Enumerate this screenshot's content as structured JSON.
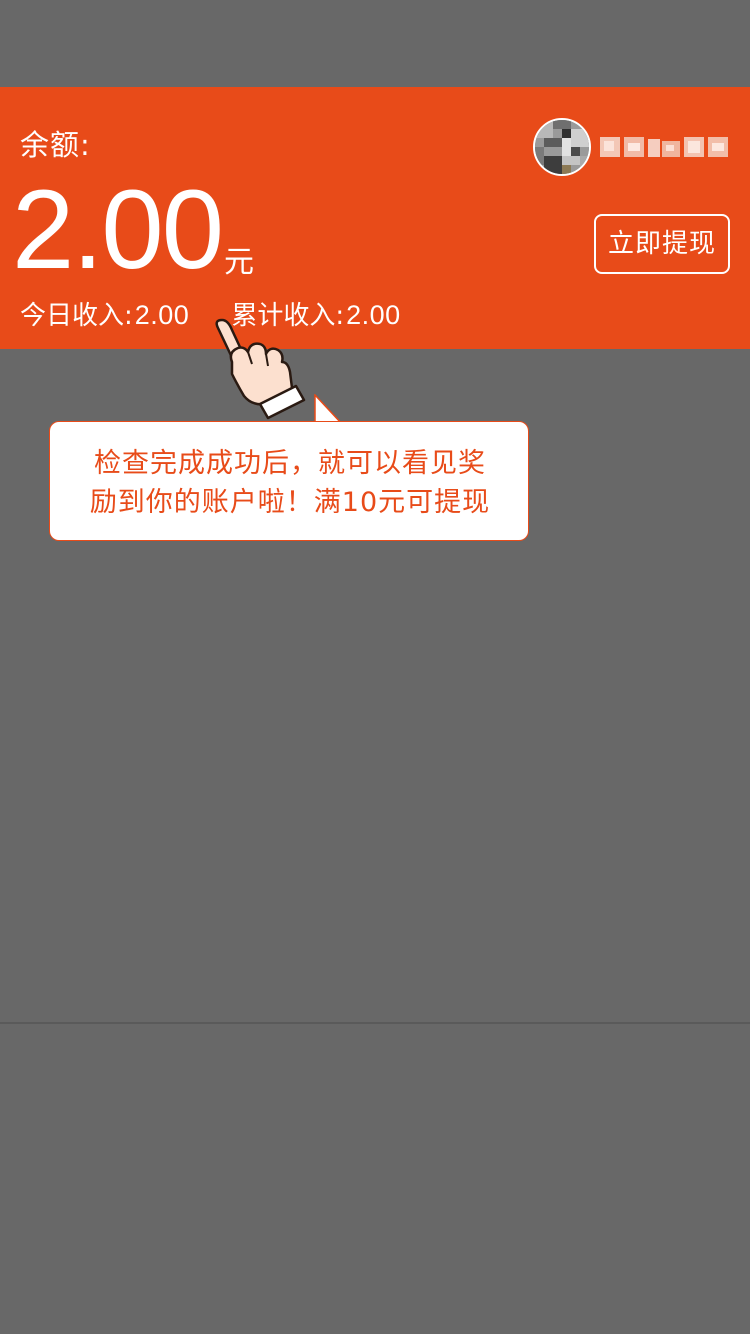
{
  "balance": {
    "label": "余额:",
    "amount": "2.00",
    "unit": "元"
  },
  "income": {
    "today_label": "今日收入:",
    "today_value": "2.00",
    "total_label": "累计收入:",
    "total_value": "2.00"
  },
  "user": {
    "avatar_icon": "avatar-icon",
    "name_icon": "blurred-username"
  },
  "actions": {
    "withdraw_label": "立即提现"
  },
  "tooltip": {
    "line1": "检查完成成功后，就可以看见奖",
    "line2": "励到你的账户啦！满10元可提现"
  },
  "colors": {
    "accent": "#E84B19",
    "overlay": "#686868"
  }
}
